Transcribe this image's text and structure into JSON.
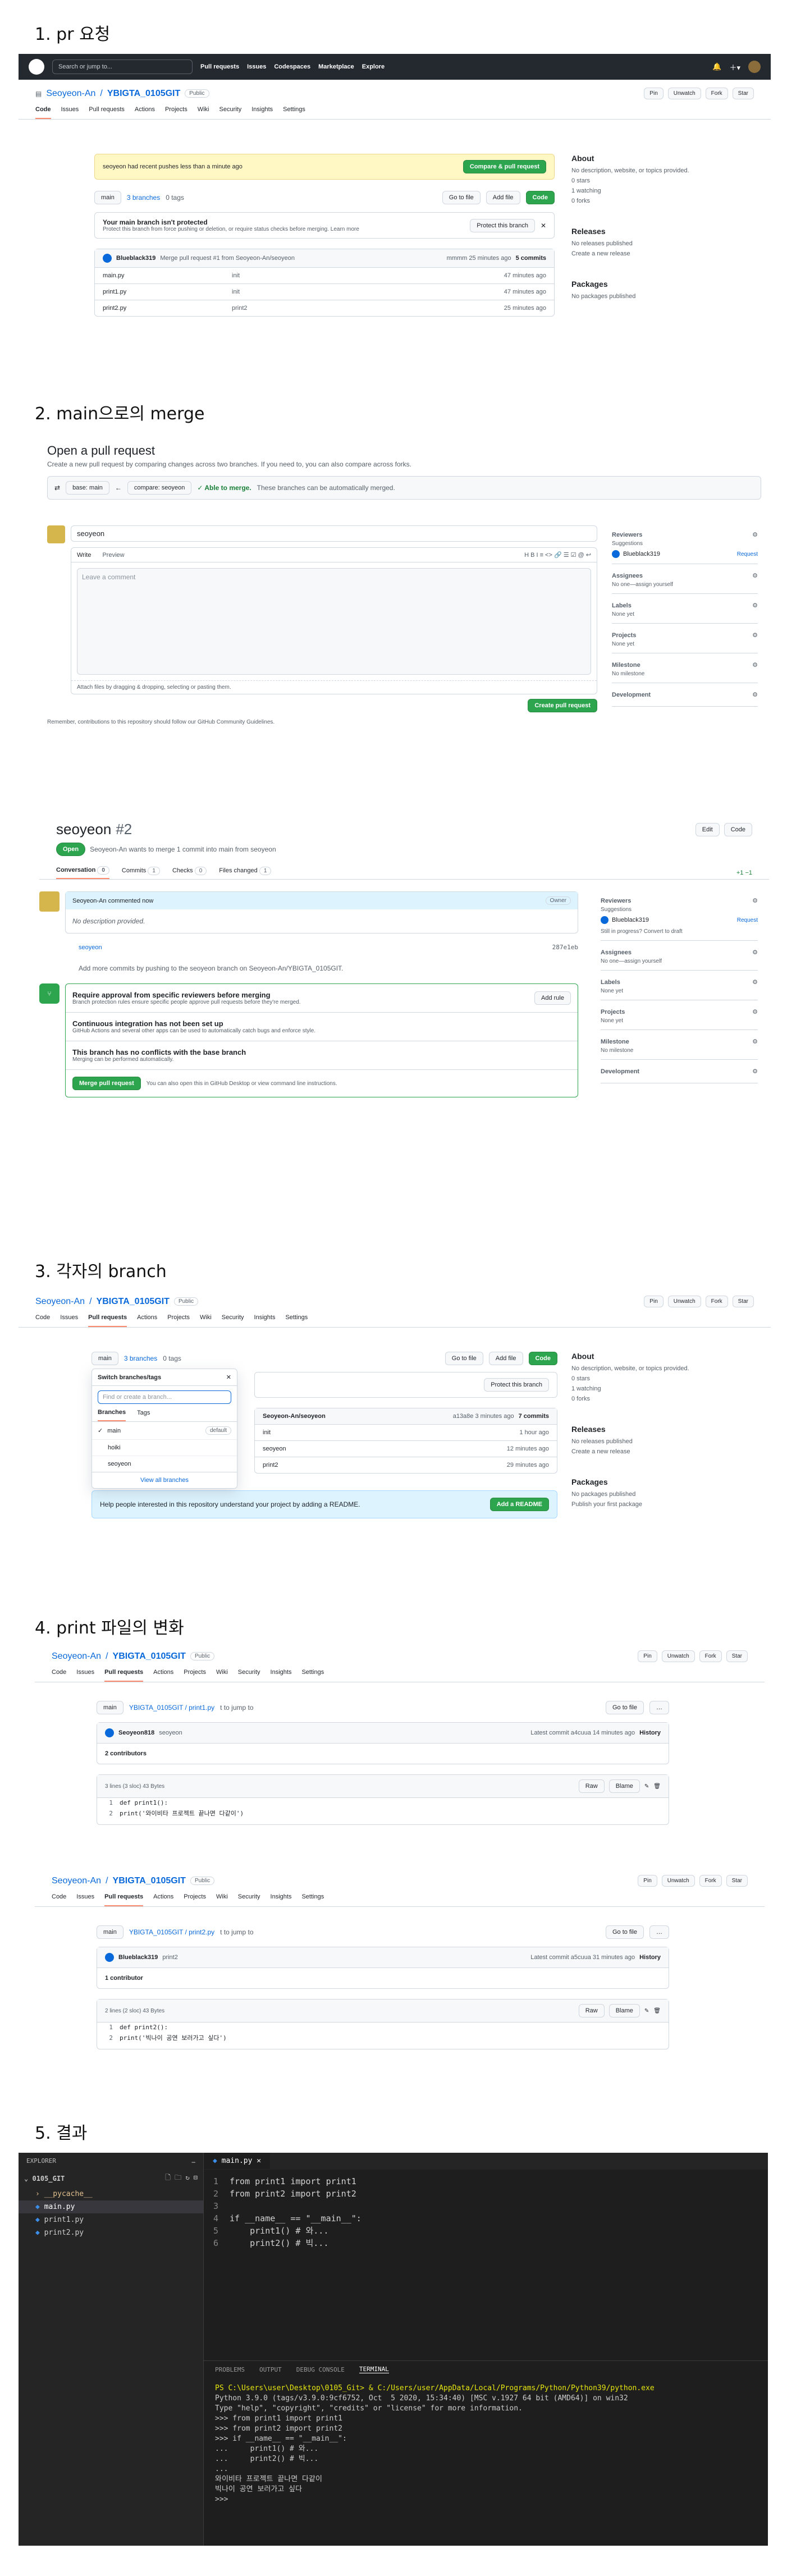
{
  "sections": {
    "s1": "1. pr 요청",
    "s2": "2. main으로의 merge",
    "s3": "3. 각자의 branch",
    "s4": "4. print 파일의 변화",
    "s5": "5. 결과"
  },
  "gh": {
    "search": "Search or jump to...",
    "nav": [
      "Pull requests",
      "Issues",
      "Codespaces",
      "Marketplace",
      "Explore"
    ],
    "owner": "Seoyeon-An",
    "repo": "YBIGTA_0105GIT",
    "public": "Public",
    "pin": "Pin",
    "unwatch": "Unwatch",
    "fork": "Fork",
    "star": "Star",
    "watch_count": "1",
    "fork_count": "0",
    "star_count": "0"
  },
  "tabs": [
    "Code",
    "Issues",
    "Pull requests",
    "Actions",
    "Projects",
    "Wiki",
    "Security",
    "Insights",
    "Settings"
  ],
  "s1": {
    "flash": "seoyeon had recent pushes less than a minute ago",
    "compare": "Compare & pull request",
    "branch": "main",
    "branches": "3 branches",
    "tags": "0 tags",
    "goto": "Go to file",
    "addfile": "Add file",
    "codebtn": "Code",
    "protect_title": "Your main branch isn't protected",
    "protect_desc": "Protect this branch from force pushing or deletion, or require status checks before merging. Learn more",
    "protect_btn": "Protect this branch",
    "commit_user": "Blueblack319",
    "commit_msg": "Merge pull request #1 from Seoyeon-An/seoyeon",
    "commit_meta": "mmmm 25 minutes ago",
    "commits": "5 commits",
    "files": [
      [
        "main.py",
        "init",
        "47 minutes ago"
      ],
      [
        "print1.py",
        "init",
        "47 minutes ago"
      ],
      [
        "print2.py",
        "print2",
        "25 minutes ago"
      ]
    ],
    "about": "About",
    "about_desc": "No description, website, or topics provided.",
    "stars": "0 stars",
    "watching": "1 watching",
    "forks": "0 forks",
    "releases": "Releases",
    "no_rel": "No releases published",
    "create_rel": "Create a new release",
    "packages": "Packages",
    "no_pkg": "No packages published"
  },
  "s2": {
    "title": "Open a pull request",
    "desc": "Create a new pull request by comparing changes across two branches. If you need to, you can also compare across forks.",
    "base": "base: main",
    "compare": "compare: seoyeon",
    "able": "✓ Able to merge.",
    "able_desc": "These branches can be automatically merged.",
    "input": "seoyeon",
    "write": "Write",
    "preview": "Preview",
    "placeholder": "Leave a comment",
    "attach": "Attach files by dragging & dropping, selecting or pasting them.",
    "create": "Create pull request",
    "remember": "Remember, contributions to this repository should follow our GitHub Community Guidelines.",
    "side": [
      {
        "h": "Reviewers",
        "t": "Suggestions",
        "u": "Blueblack319",
        "r": "Request"
      },
      {
        "h": "Assignees",
        "t": "No one—assign yourself"
      },
      {
        "h": "Labels",
        "t": "None yet"
      },
      {
        "h": "Projects",
        "t": "None yet"
      },
      {
        "h": "Milestone",
        "t": "No milestone"
      },
      {
        "h": "Development",
        "t": ""
      }
    ]
  },
  "s2b": {
    "title": "seoyeon",
    "num": "#2",
    "open": "Open",
    "meta": "Seoyeon-An wants to merge 1 commit into main from seoyeon",
    "edit": "Edit",
    "code": "Code",
    "tabs": [
      [
        "Conversation",
        "0"
      ],
      [
        "Commits",
        "1"
      ],
      [
        "Checks",
        "0"
      ],
      [
        "Files changed",
        "1"
      ]
    ],
    "diff": "+1 −1",
    "commented": "Seoyeon-An commented now",
    "owner": "Owner",
    "nodesc": "No description provided.",
    "commit": "seoyeon",
    "sha": "287e1eb",
    "addmore": "Add more commits by pushing to the seoyeon branch on Seoyeon-An/YBIGTA_0105GIT.",
    "req_t": "Require approval from specific reviewers before merging",
    "req_d": "Branch protection rules ensure specific people approve pull requests before they're merged.",
    "addrule": "Add rule",
    "ci_t": "Continuous integration has not been set up",
    "ci_d": "GitHub Actions and several other apps can be used to automatically catch bugs and enforce style.",
    "ok_t": "This branch has no conflicts with the base branch",
    "ok_d": "Merging can be performed automatically.",
    "merge": "Merge pull request",
    "also": "You can also open this in GitHub Desktop or view command line instructions.",
    "side": [
      {
        "h": "Reviewers",
        "t": "Suggestions",
        "u": "Blueblack319",
        "r": "Request",
        "x": "Still in progress? Convert to draft"
      },
      {
        "h": "Assignees",
        "t": "No one—assign yourself"
      },
      {
        "h": "Labels",
        "t": "None yet"
      },
      {
        "h": "Projects",
        "t": "None yet"
      },
      {
        "h": "Milestone",
        "t": "No milestone"
      },
      {
        "h": "Development",
        "t": ""
      }
    ]
  },
  "s3": {
    "switch": "Switch branches/tags",
    "find": "Find or create a branch...",
    "btabs": [
      "Branches",
      "Tags"
    ],
    "branches": [
      "main",
      "hoiki",
      "seoyeon"
    ],
    "default": "default",
    "viewall": "View all branches",
    "commit_user": "Seoyeon-An/seoyeon",
    "commit_meta": "a13a8e 3 minutes ago",
    "commits": "7 commits",
    "files": [
      [
        "",
        "init",
        "1 hour ago"
      ],
      [
        "",
        "seoyeon",
        "12 minutes ago"
      ],
      [
        "print2",
        "print2",
        "29 minutes ago"
      ]
    ],
    "readme": "Help people interested in this repository understand your project by adding a README.",
    "addreadme": "Add a README",
    "publish": "Publish your first package"
  },
  "s4": {
    "f1": {
      "path": "YBIGTA_0105GIT / print1.py",
      "user": "Seoyeon818",
      "msg": "seoyeon",
      "latest": "Latest commit a4cuua 14 minutes ago",
      "contrib": "2 contributors",
      "meta": "3 lines (3 sloc)   43 Bytes",
      "lines": [
        "def print1():",
        "    print('와이비타 프로젝트 끝나면 다같이')"
      ]
    },
    "f2": {
      "path": "YBIGTA_0105GIT / print2.py",
      "user": "Blueblack319",
      "msg": "print2",
      "latest": "Latest commit a5cuua 31 minutes ago",
      "contrib": "1 contributor",
      "meta": "2 lines (2 sloc)   43 Bytes",
      "lines": [
        "def print2():",
        "    print('빅나이 공연 보러가고 싶다')"
      ]
    },
    "history": "History",
    "raw": "Raw",
    "blame": "Blame",
    "jump": "t to jump to",
    "goto": "Go to file"
  },
  "s5": {
    "explorer": "EXPLORER",
    "folder": "0105_GIT",
    "files": [
      "__pycache__",
      "main.py",
      "print1.py",
      "print2.py"
    ],
    "tab": "main.py",
    "code": [
      [
        "from print1 import print1"
      ],
      [
        "from print2 import print2"
      ],
      [
        ""
      ],
      [
        "if __name__ == \"__main__\":"
      ],
      [
        "    print1() # 와..."
      ],
      [
        "    print2() # 빅..."
      ]
    ],
    "ptabs": [
      "PROBLEMS",
      "OUTPUT",
      "DEBUG CONSOLE",
      "TERMINAL"
    ],
    "term": [
      "PS C:\\Users\\user\\Desktop\\0105_Git> & C:/Users/user/AppData/Local/Programs/Python/Python39/python.exe",
      "Python 3.9.0 (tags/v3.9.0:9cf6752, Oct  5 2020, 15:34:40) [MSC v.1927 64 bit (AMD64)] on win32",
      "Type \"help\", \"copyright\", \"credits\" or \"license\" for more information.",
      ">>> from print1 import print1",
      ">>> from print2 import print2",
      ">>> if __name__ == \"__main__\":",
      "...     print1() # 와...",
      "...     print2() # 빅...",
      "...",
      "와이비타 프로젝트 끝나면 다같이",
      "빅나이 공연 보러가고 싶다",
      ">>> "
    ]
  }
}
